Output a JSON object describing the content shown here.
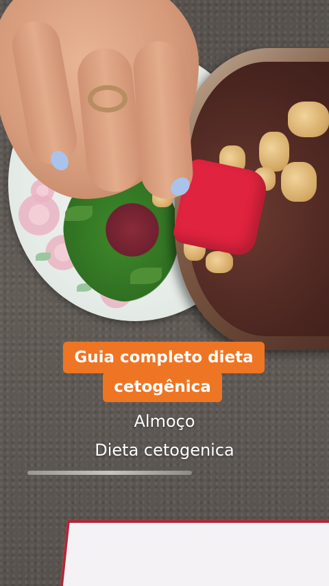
{
  "caption": {
    "line1": "Guia completo dieta",
    "line2": "cetogênica",
    "accent_color": "#ee7524"
  },
  "subtitle": {
    "line1": "Almoço",
    "line2": "Dieta cetogenica"
  }
}
